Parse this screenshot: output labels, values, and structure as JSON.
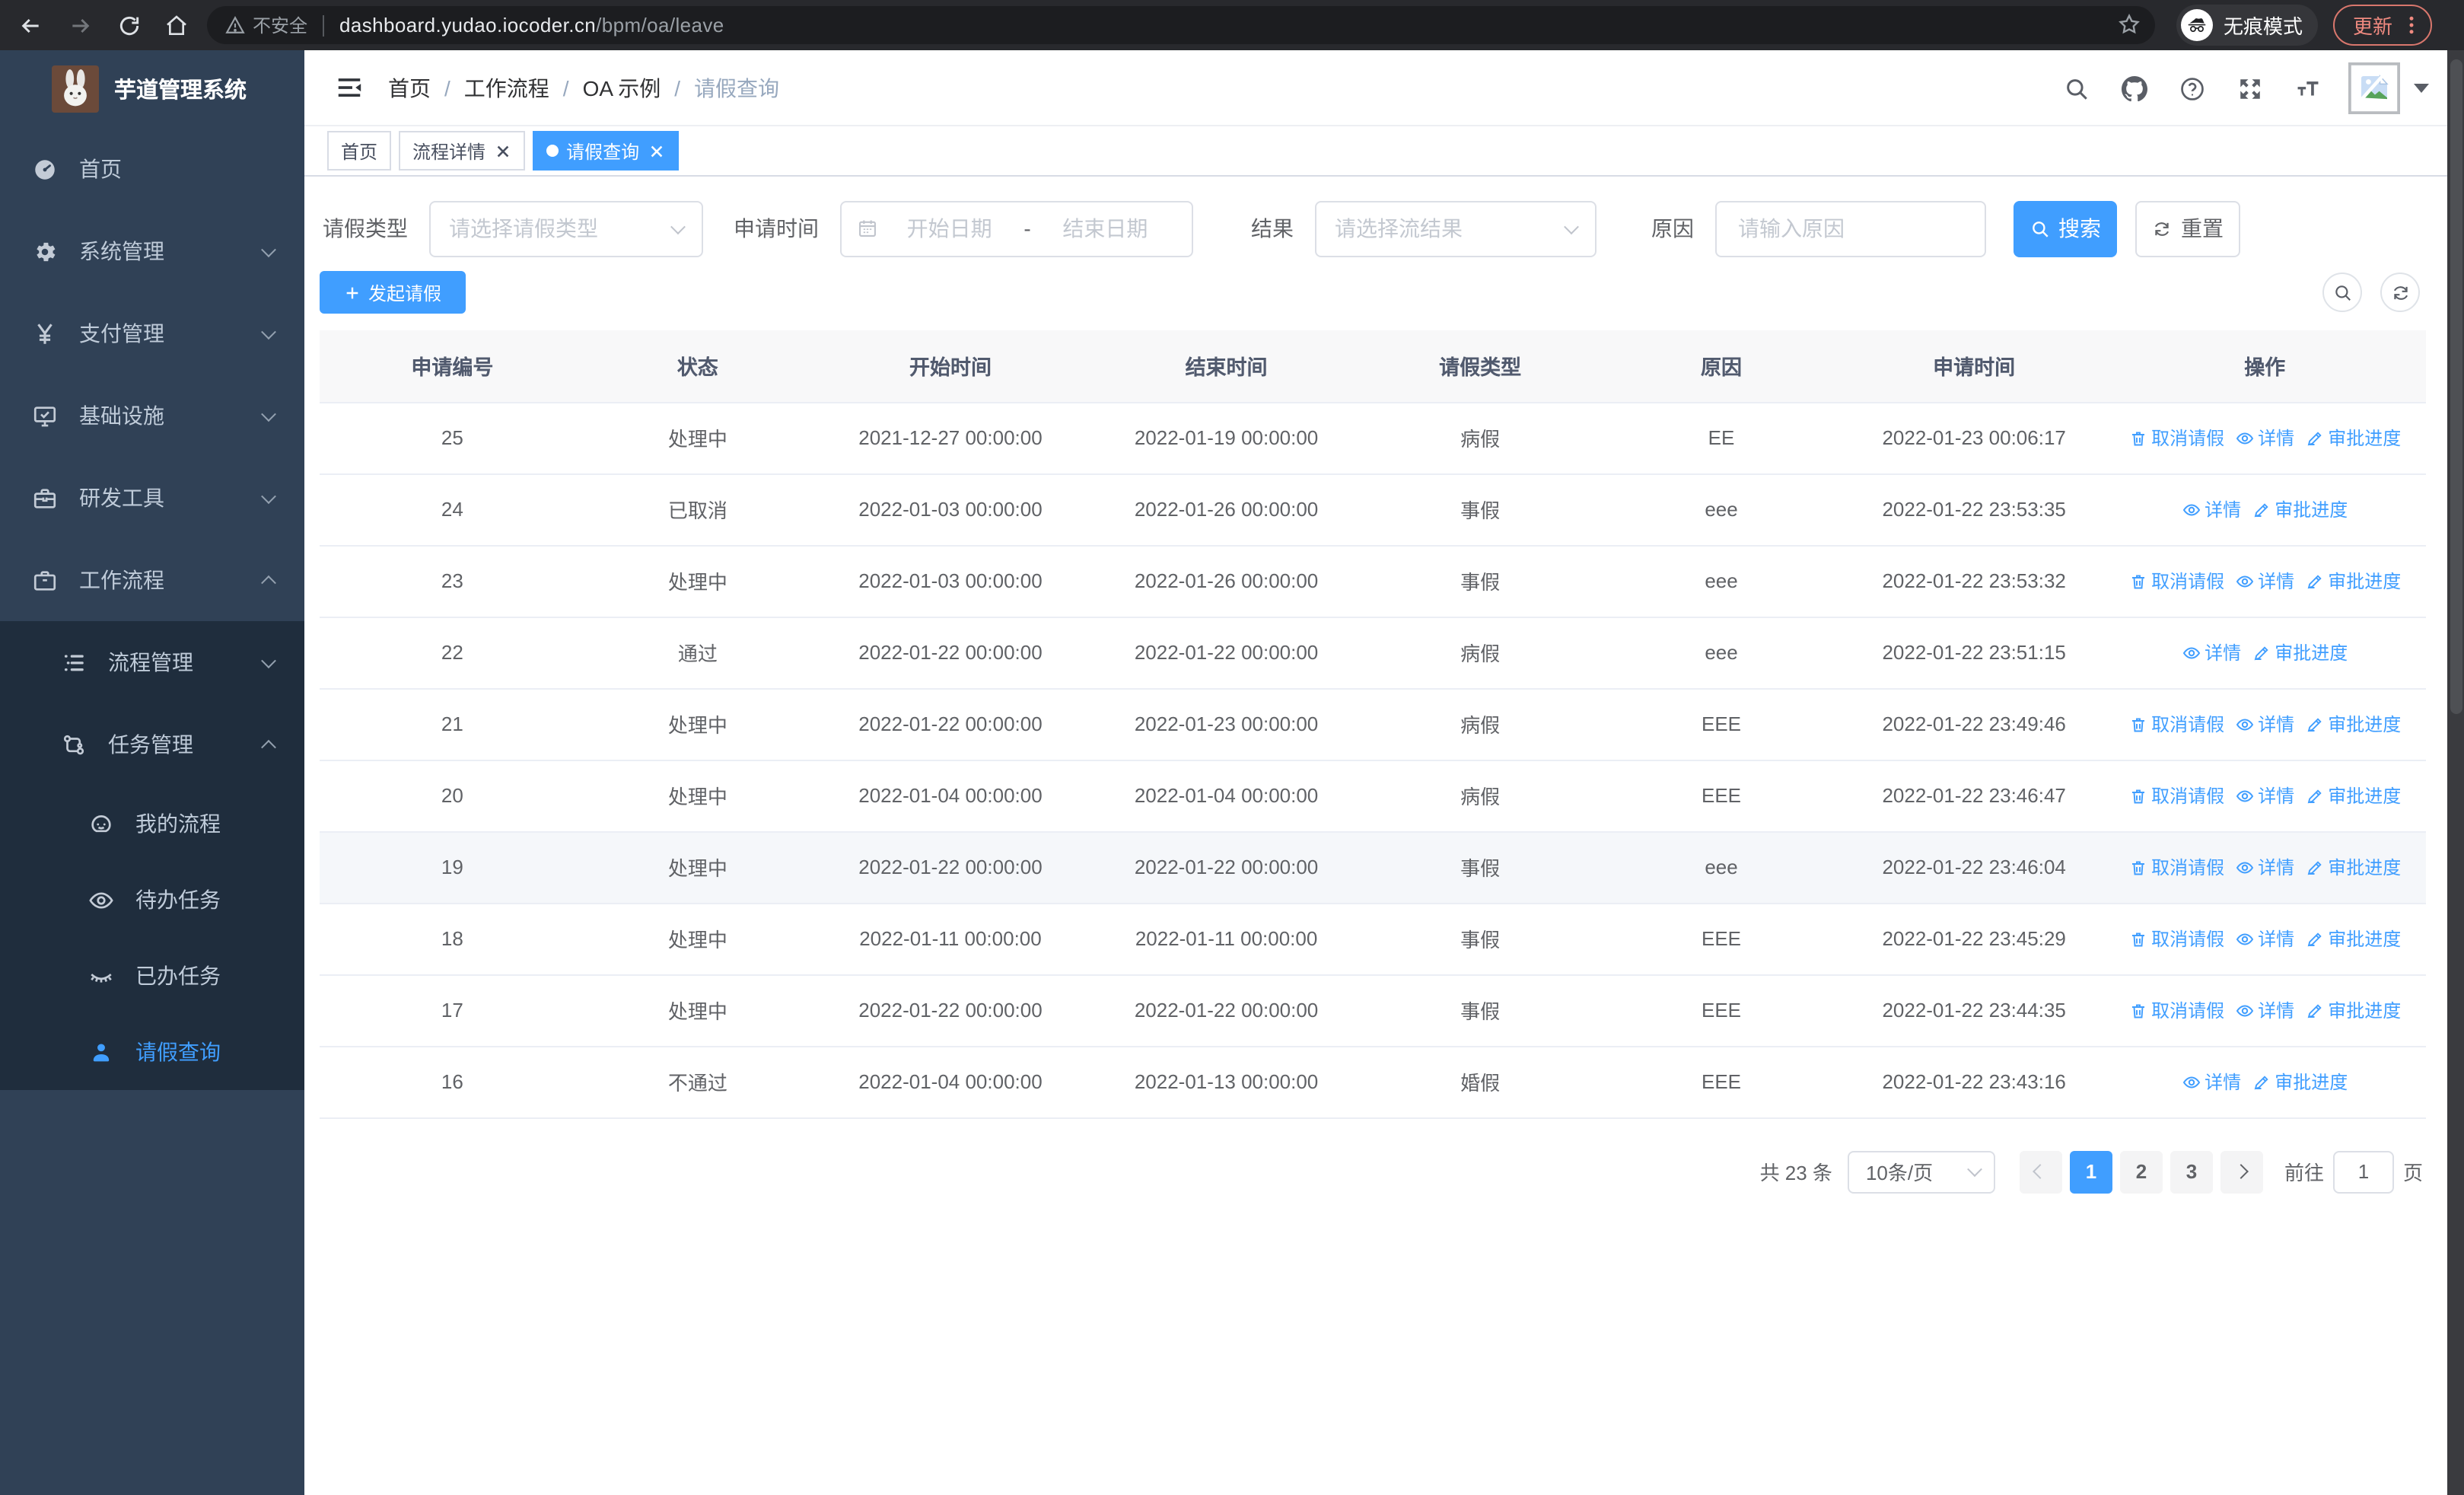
{
  "browser": {
    "security_label": "不安全",
    "url_host": "dashboard.yudao.iocoder.cn",
    "url_path": "/bpm/oa/leave",
    "incognito_label": "无痕模式",
    "update_label": "更新"
  },
  "sidebar": {
    "logo_title": "芋道管理系统",
    "menu": [
      {
        "key": "home",
        "label": "首页",
        "icon": "dashboard",
        "level": 1
      },
      {
        "key": "system-management",
        "label": "系统管理",
        "icon": "gear",
        "level": 1,
        "chevron": "down"
      },
      {
        "key": "payment-management",
        "label": "支付管理",
        "icon": "yen",
        "level": 1,
        "chevron": "down"
      },
      {
        "key": "infrastructure",
        "label": "基础设施",
        "icon": "monitor",
        "level": 1,
        "chevron": "down"
      },
      {
        "key": "dev-tools",
        "label": "研发工具",
        "icon": "toolbox",
        "level": 1,
        "chevron": "down"
      },
      {
        "key": "workflow",
        "label": "工作流程",
        "icon": "briefcase",
        "level": 1,
        "chevron": "up"
      },
      {
        "key": "process-management",
        "label": "流程管理",
        "icon": "flow-list",
        "level": 2,
        "chevron": "down",
        "sub": true
      },
      {
        "key": "task-management",
        "label": "任务管理",
        "icon": "org",
        "level": 2,
        "chevron": "up",
        "sub": true
      },
      {
        "key": "my-process",
        "label": "我的流程",
        "icon": "face",
        "level": 3,
        "sub": true
      },
      {
        "key": "todo-tasks",
        "label": "待办任务",
        "icon": "eye",
        "level": 3,
        "sub": true
      },
      {
        "key": "done-tasks",
        "label": "已办任务",
        "icon": "eye-off",
        "level": 3,
        "sub": true
      },
      {
        "key": "leave-query",
        "label": "请假查询",
        "icon": "user",
        "level": 3,
        "sub": true,
        "active": true
      }
    ]
  },
  "header": {
    "breadcrumb": [
      "首页",
      "工作流程",
      "OA 示例",
      "请假查询"
    ],
    "breadcrumb_separator": "/"
  },
  "tags": [
    {
      "label": "首页",
      "closable": false,
      "active": false
    },
    {
      "label": "流程详情",
      "closable": true,
      "active": false
    },
    {
      "label": "请假查询",
      "closable": true,
      "active": true
    }
  ],
  "filters": {
    "leave_type": {
      "label": "请假类型",
      "placeholder": "请选择请假类型"
    },
    "apply_time": {
      "label": "申请时间",
      "start_placeholder": "开始日期",
      "separator": "-",
      "end_placeholder": "结束日期"
    },
    "result": {
      "label": "结果",
      "placeholder": "请选择流结果"
    },
    "reason": {
      "label": "原因",
      "placeholder": "请输入原因"
    },
    "search_label": "搜索",
    "reset_label": "重置"
  },
  "toolbar": {
    "create_label": "发起请假"
  },
  "table": {
    "columns": [
      "申请编号",
      "状态",
      "开始时间",
      "结束时间",
      "请假类型",
      "原因",
      "申请时间",
      "操作"
    ],
    "action_labels": {
      "cancel": "取消请假",
      "detail": "详情",
      "progress": "审批进度"
    },
    "rows": [
      {
        "id": "25",
        "status": "处理中",
        "start": "2021-12-27 00:00:00",
        "end": "2022-01-19 00:00:00",
        "type": "病假",
        "reason": "EE",
        "applied": "2022-01-23 00:06:17",
        "cancel": true
      },
      {
        "id": "24",
        "status": "已取消",
        "start": "2022-01-03 00:00:00",
        "end": "2022-01-26 00:00:00",
        "type": "事假",
        "reason": "eee",
        "applied": "2022-01-22 23:53:35",
        "cancel": false
      },
      {
        "id": "23",
        "status": "处理中",
        "start": "2022-01-03 00:00:00",
        "end": "2022-01-26 00:00:00",
        "type": "事假",
        "reason": "eee",
        "applied": "2022-01-22 23:53:32",
        "cancel": true
      },
      {
        "id": "22",
        "status": "通过",
        "start": "2022-01-22 00:00:00",
        "end": "2022-01-22 00:00:00",
        "type": "病假",
        "reason": "eee",
        "applied": "2022-01-22 23:51:15",
        "cancel": false
      },
      {
        "id": "21",
        "status": "处理中",
        "start": "2022-01-22 00:00:00",
        "end": "2022-01-23 00:00:00",
        "type": "病假",
        "reason": "EEE",
        "applied": "2022-01-22 23:49:46",
        "cancel": true
      },
      {
        "id": "20",
        "status": "处理中",
        "start": "2022-01-04 00:00:00",
        "end": "2022-01-04 00:00:00",
        "type": "病假",
        "reason": "EEE",
        "applied": "2022-01-22 23:46:47",
        "cancel": true
      },
      {
        "id": "19",
        "status": "处理中",
        "start": "2022-01-22 00:00:00",
        "end": "2022-01-22 00:00:00",
        "type": "事假",
        "reason": "eee",
        "applied": "2022-01-22 23:46:04",
        "cancel": true,
        "hover": true
      },
      {
        "id": "18",
        "status": "处理中",
        "start": "2022-01-11 00:00:00",
        "end": "2022-01-11 00:00:00",
        "type": "事假",
        "reason": "EEE",
        "applied": "2022-01-22 23:45:29",
        "cancel": true
      },
      {
        "id": "17",
        "status": "处理中",
        "start": "2022-01-22 00:00:00",
        "end": "2022-01-22 00:00:00",
        "type": "事假",
        "reason": "EEE",
        "applied": "2022-01-22 23:44:35",
        "cancel": true
      },
      {
        "id": "16",
        "status": "不通过",
        "start": "2022-01-04 00:00:00",
        "end": "2022-01-13 00:00:00",
        "type": "婚假",
        "reason": "EEE",
        "applied": "2022-01-22 23:43:16",
        "cancel": false
      }
    ]
  },
  "pagination": {
    "total_label": "共 23 条",
    "page_size_label": "10条/页",
    "pages": [
      "1",
      "2",
      "3"
    ],
    "active_page": "1",
    "goto_label": "前往",
    "goto_value": "1",
    "page_unit": "页"
  },
  "colors": {
    "accent": "#409eff",
    "sidebar_bg": "#304156",
    "sidebar_submenu_bg": "#1f2d3d",
    "active_tag": "#409eff",
    "update_button": "#f08a80",
    "table_header_bg": "#f8f8f9",
    "hover_row_bg": "#f5f7fa"
  }
}
